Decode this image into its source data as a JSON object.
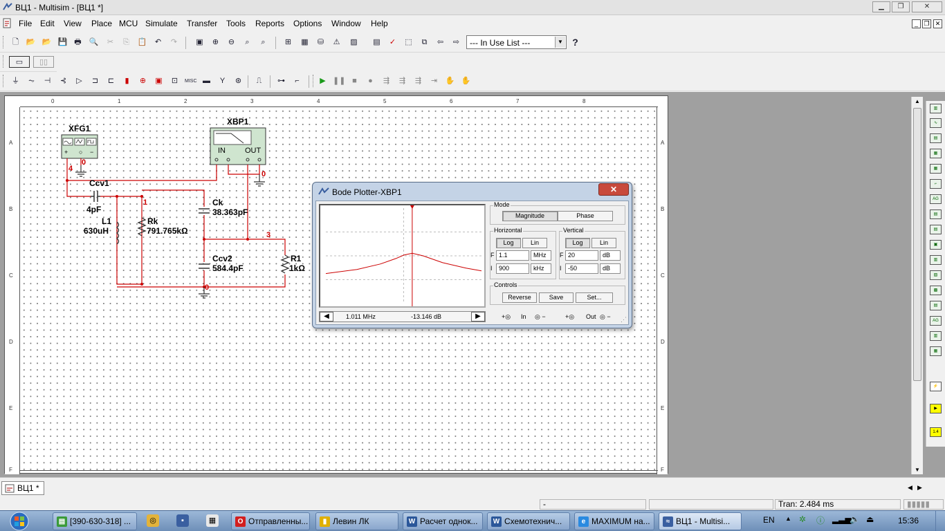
{
  "window": {
    "title": "ВЦ1 - Multisim - [ВЦ1 *]"
  },
  "menu": [
    "File",
    "Edit",
    "View",
    "Place",
    "MCU",
    "Simulate",
    "Transfer",
    "Tools",
    "Reports",
    "Options",
    "Window",
    "Help"
  ],
  "toolbar": {
    "in_use_list": "--- In Use List ---"
  },
  "ruler": {
    "top": [
      "0",
      "1",
      "2",
      "3",
      "4",
      "5",
      "6",
      "7",
      "8"
    ],
    "side": [
      "A",
      "B",
      "C",
      "D",
      "E",
      "F"
    ]
  },
  "schematic": {
    "xfg1": "XFG1",
    "xbp1": "XBP1",
    "xbp1_in": "IN",
    "xbp1_out": "OUT",
    "ccv1": "Ccv1",
    "ccv1_val": "4pF",
    "l1": "L1",
    "l1_val": "630uH",
    "rk": "Rk",
    "rk_val": "791.765kΩ",
    "ck": "Ck",
    "ck_val": "38.363pF",
    "ccv2": "Ccv2",
    "ccv2_val": "584.4pF",
    "r1": "R1",
    "r1_val": "1kΩ",
    "nodes": {
      "n4": "4",
      "n0a": "0",
      "n0b": "0",
      "n1": "1",
      "n3": "3",
      "n0c": "0"
    }
  },
  "bode": {
    "title": "Bode Plotter-XBP1",
    "mode_label": "Mode",
    "magnitude": "Magnitude",
    "phase": "Phase",
    "horizontal_label": "Horizontal",
    "vertical_label": "Vertical",
    "log": "Log",
    "lin": "Lin",
    "f_letter": "F",
    "i_letter": "I",
    "h_final": "1.1",
    "h_final_unit": "MHz",
    "h_initial": "900",
    "h_initial_unit": "kHz",
    "v_final": "20",
    "v_final_unit": "dB",
    "v_initial": "-50",
    "v_initial_unit": "dB",
    "controls_label": "Controls",
    "reverse": "Reverse",
    "save": "Save",
    "set": "Set...",
    "cursor_freq": "1.011 MHz",
    "cursor_db": "-13.146 dB",
    "in_label": "In",
    "out_label": "Out"
  },
  "chart_data": {
    "type": "line",
    "title": "",
    "xlabel": "",
    "ylabel": "",
    "xlim": [
      900,
      1100
    ],
    "x_units": "kHz",
    "ylim": [
      -50,
      20
    ],
    "series": [
      {
        "x": [
          900,
          940,
          970,
          990,
          1000,
          1011,
          1025,
          1050,
          1080,
          1100
        ],
        "values": [
          -28,
          -25,
          -21,
          -17,
          -14.5,
          -13.146,
          -15,
          -20,
          -24,
          -26
        ]
      }
    ],
    "cursor_x": 1011,
    "line_color": "#cc0000",
    "grid": true
  },
  "tab": {
    "label": "ВЦ1 *"
  },
  "status": {
    "left": "-",
    "tran": "Tran: 2.484 ms"
  },
  "taskbar": {
    "tasks": [
      "[390-630-318] ...",
      "Отправленны...",
      "Левин ЛК",
      "Расчет однок...",
      "Схемотехнич...",
      "MAXIMUM на...",
      "ВЦ1 - Multisi..."
    ],
    "lang": "EN",
    "clock": "15:36"
  }
}
